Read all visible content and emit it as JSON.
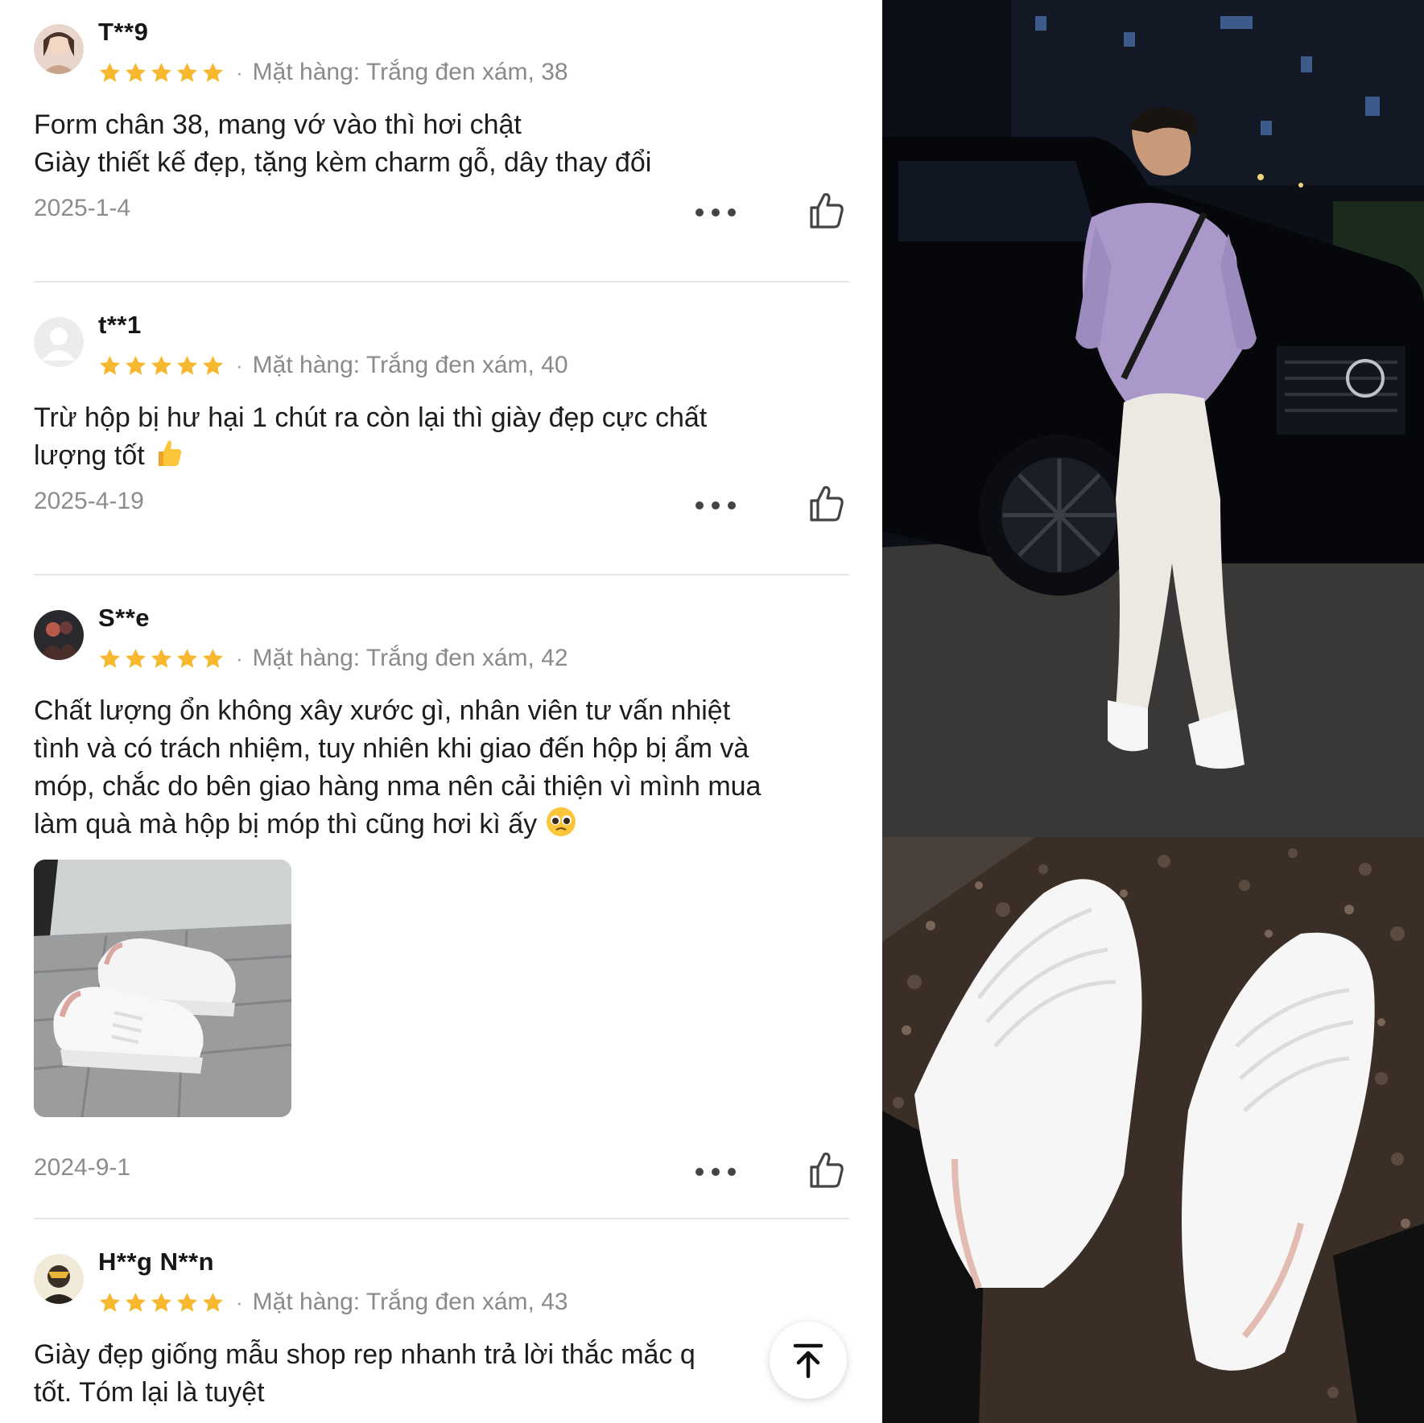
{
  "reviews": [
    {
      "username": "T**9",
      "rating": 5,
      "variant": "Mặt hàng: Trắng đen xám, 38",
      "text_lines": [
        "Form chân 38, mang vớ vào thì hơi chật",
        "Giày thiết kế đẹp, tặng kèm charm gỗ, dây thay đổi"
      ],
      "date": "2025-1-4",
      "avatar": "user-photo-avatar"
    },
    {
      "username": "t**1",
      "rating": 5,
      "variant": "Mặt hàng: Trắng đen xám, 40",
      "text_lines": [
        "Trừ hộp bị hư hại 1 chút ra còn lại thì giày đẹp cực chất",
        "lượng tốt"
      ],
      "emoji": "thumbs-up-emoji",
      "date": "2025-4-19",
      "avatar": "default-avatar"
    },
    {
      "username": "S**e",
      "rating": 5,
      "variant": "Mặt hàng: Trắng đen xám, 42",
      "text_lines": [
        "Chất lượng ổn không xây xước gì, nhân viên tư vấn nhiệt",
        "tình và có trách nhiệm, tuy nhiên khi giao đến hộp bị ẩm và",
        "móp, chắc do bên giao hàng nma nên cải thiện vì mình mua",
        "làm quà mà hộp bị móp thì cũng hơi kì ấy"
      ],
      "emoji": "pleading-face-emoji",
      "photo": "review-photo-sneakers",
      "date": "2024-9-1",
      "avatar": "user-photo-avatar"
    },
    {
      "username": "H**g N**n",
      "rating": 5,
      "variant": "Mặt hàng: Trắng đen xám, 43",
      "text_lines": [
        "Giày đẹp giống mẫu shop rep nhanh trả lời thắc mắc q",
        "tốt. Tóm lại là tuyệt"
      ],
      "avatar": "user-photo-avatar"
    }
  ],
  "icons": {
    "star": "star-icon",
    "more": "more-options-icon",
    "like": "thumbs-up-outline-icon",
    "scroll_top": "arrow-up-to-top-icon"
  },
  "colors": {
    "star": "#F5B82E",
    "meta_text": "#8a8a8a",
    "divider": "#e6e6e6"
  },
  "side_photos": [
    "model-leaning-on-car-photo",
    "sneakers-on-gravel-photo"
  ]
}
